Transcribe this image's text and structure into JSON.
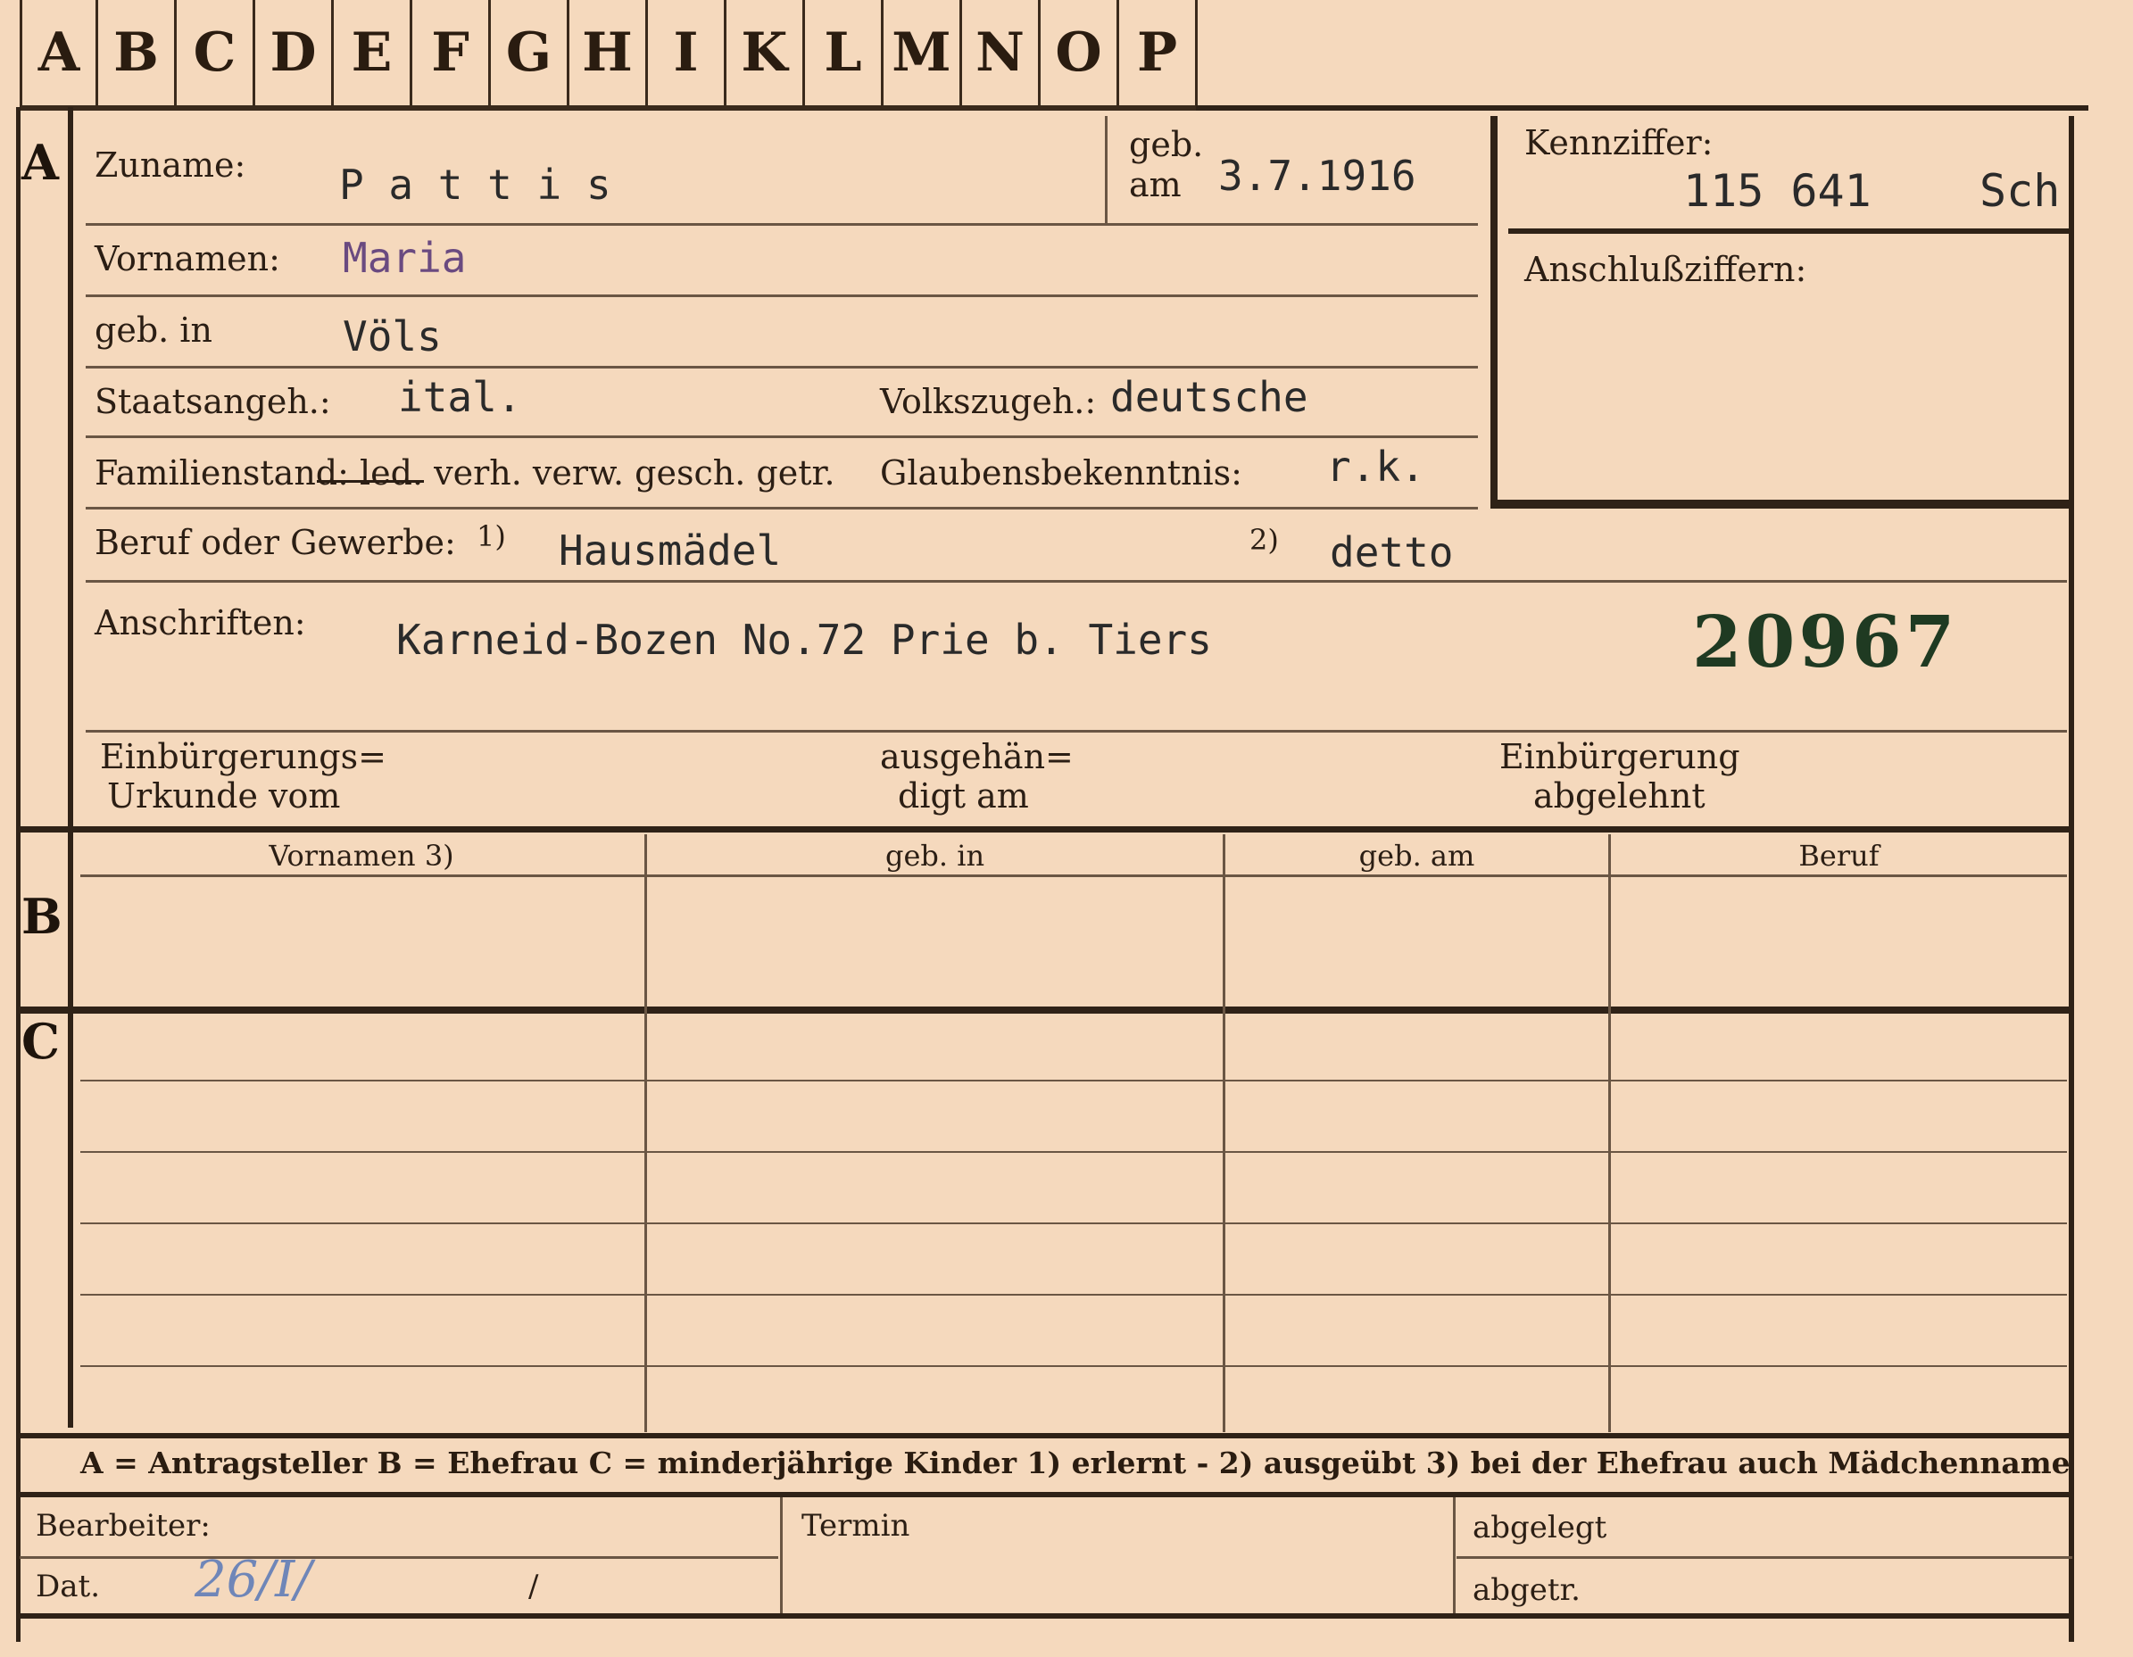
{
  "tabs": [
    "A",
    "B",
    "C",
    "D",
    "E",
    "F",
    "G",
    "H",
    "I",
    "K",
    "L",
    "M",
    "N",
    "O",
    "P"
  ],
  "section_letters": {
    "a": "A",
    "b": "B",
    "c": "C"
  },
  "person": {
    "zuname_label": "Zuname:",
    "zuname_value": "P a t t i s",
    "geb_am_label_1": "geb.",
    "geb_am_label_2": "am",
    "geb_am_value": "3.7.1916",
    "vornamen_label": "Vornamen:",
    "vornamen_value": "Maria",
    "geb_in_label": "geb. in",
    "geb_in_value": "Völs",
    "staatsangeh_label": "Staatsangeh.:",
    "staatsangeh_value": "ital.",
    "volkszugeh_label": "Volkszugeh.:",
    "volkszugeh_value": "deutsche",
    "familienstand_label": "Familienstand: led. verh. verw. gesch. getr.",
    "glaubens_label": "Glaubensbekenntnis:",
    "glaubens_value": "r.k.",
    "beruf_label": "Beruf oder Gewerbe:",
    "beruf_mark1": "1)",
    "beruf_value1": "Hausmädel",
    "beruf_mark2": "2)",
    "beruf_value2": "detto",
    "anschriften_label": "Anschriften:",
    "anschriften_value": "Karneid-Bozen No.72 Prie b. Tiers",
    "stamp_number": "20967",
    "einb_label_1": "Einbürgerungs=",
    "einb_label_2": "Urkunde vom",
    "ausgeh_label_1": "ausgehän=",
    "ausgeh_label_2": "digt am",
    "abgelehnt_label_1": "Einbürgerung",
    "abgelehnt_label_2": "abgelehnt"
  },
  "kennziffer": {
    "label": "Kennziffer:",
    "value": "115 641",
    "suffix": "Sch",
    "anschluss_label": "Anschlußziffern:"
  },
  "family_table": {
    "headers": [
      "Vornamen 3)",
      "geb. in",
      "geb. am",
      "Beruf"
    ]
  },
  "legend": "A = Antragsteller   B = Ehefrau   C = minderjährige Kinder   1) erlernt - 2) ausgeübt   3) bei der Ehefrau auch Mädchenname",
  "footer": {
    "bearbeiter_label": "Bearbeiter:",
    "dat_label": "Dat.",
    "dat_value": "26/I/",
    "dat_slash": "/",
    "termin_label": "Termin",
    "abgelegt_label": "abgelegt",
    "abgetr_label": "abgetr."
  },
  "colors": {
    "paper": "#f5d9bd",
    "ink": "#2b1e14",
    "stamp": "#1f3a22",
    "vornamen_ink": "#6a4a80",
    "pencil": "#6f86b8"
  }
}
